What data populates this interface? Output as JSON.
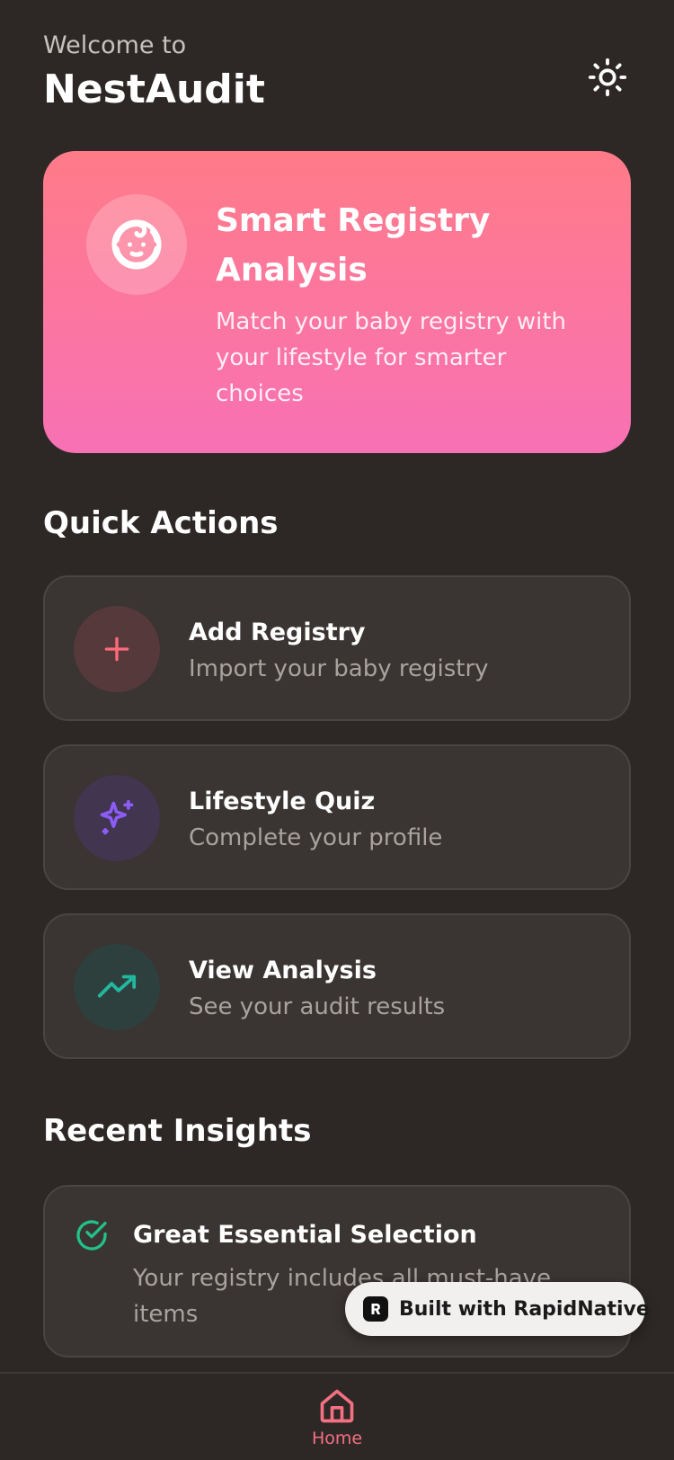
{
  "header": {
    "welcome": "Welcome to",
    "app_title": "NestAudit",
    "theme_icon": "sun-icon"
  },
  "hero": {
    "icon": "baby-face-icon",
    "title": "Smart Registry Analysis",
    "subtitle": "Match your baby registry with your lifestyle for smarter choices",
    "gradient_top": "#ff7b88",
    "gradient_bottom": "#f871b5"
  },
  "quick_actions": {
    "title": "Quick Actions",
    "items": [
      {
        "title": "Add Registry",
        "subtitle": "Import your baby registry",
        "icon": "plus-icon",
        "color": "#ff6b7a"
      },
      {
        "title": "Lifestyle Quiz",
        "subtitle": "Complete your profile",
        "icon": "sparkles-icon",
        "color": "#8b5cf6"
      },
      {
        "title": "View Analysis",
        "subtitle": "See your audit results",
        "icon": "trending-up-icon",
        "color": "#22b8a0"
      }
    ]
  },
  "recent_insights": {
    "title": "Recent Insights",
    "items": [
      {
        "title": "Great Essential Selection",
        "subtitle": "Your registry includes all must-have items",
        "icon": "check-circle-icon",
        "color": "#22c08a"
      }
    ]
  },
  "badge": {
    "label": "Built with RapidNative"
  },
  "tabbar": {
    "home_label": "Home",
    "active_color": "#f57082"
  }
}
